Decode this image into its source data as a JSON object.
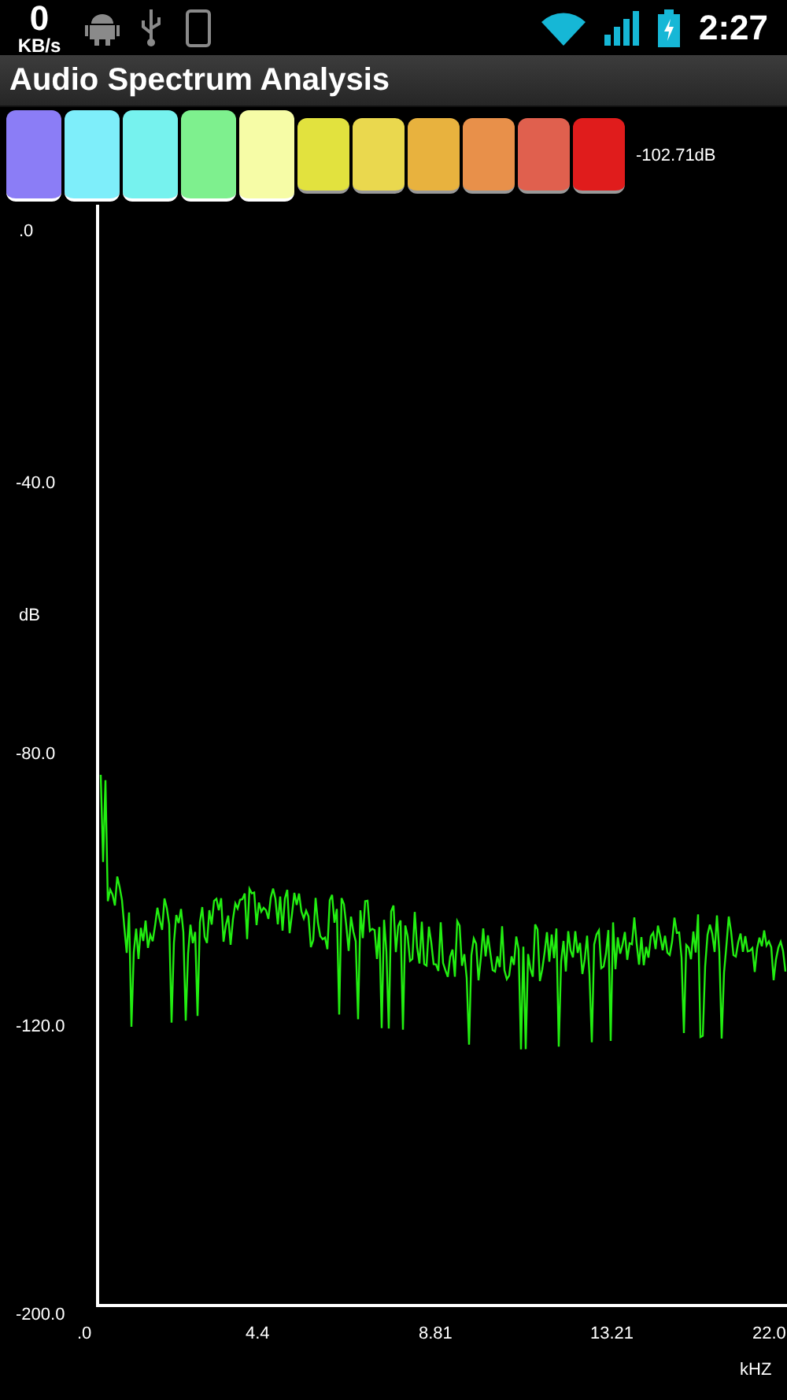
{
  "status_bar": {
    "speed_value": "0",
    "speed_unit": "KB/s",
    "time": "2:27"
  },
  "title_bar": {
    "title": "Audio Spectrum Analysis"
  },
  "level_meter": {
    "reading": "-102.71dB",
    "segments": [
      {
        "lit": true,
        "color": "#8b7df6"
      },
      {
        "lit": true,
        "color": "#7eeefa"
      },
      {
        "lit": true,
        "color": "#76f2ee"
      },
      {
        "lit": true,
        "color": "#7ef08e"
      },
      {
        "lit": true,
        "color": "#f6fca6"
      },
      {
        "lit": false,
        "color": "#e2e23e"
      },
      {
        "lit": false,
        "color": "#ead84e"
      },
      {
        "lit": false,
        "color": "#e8b23e"
      },
      {
        "lit": false,
        "color": "#e8904a"
      },
      {
        "lit": false,
        "color": "#e0604e"
      },
      {
        "lit": false,
        "color": "#e01c1c"
      }
    ]
  },
  "spectrum": {
    "y_unit": "dB",
    "x_unit": "kHZ",
    "y_labels": [
      ".0",
      "-40.0",
      "-80.0",
      "-120.0",
      "-200.0"
    ],
    "x_labels": [
      ".0",
      "4.4",
      "8.81",
      "13.21",
      "22.0"
    ]
  }
}
